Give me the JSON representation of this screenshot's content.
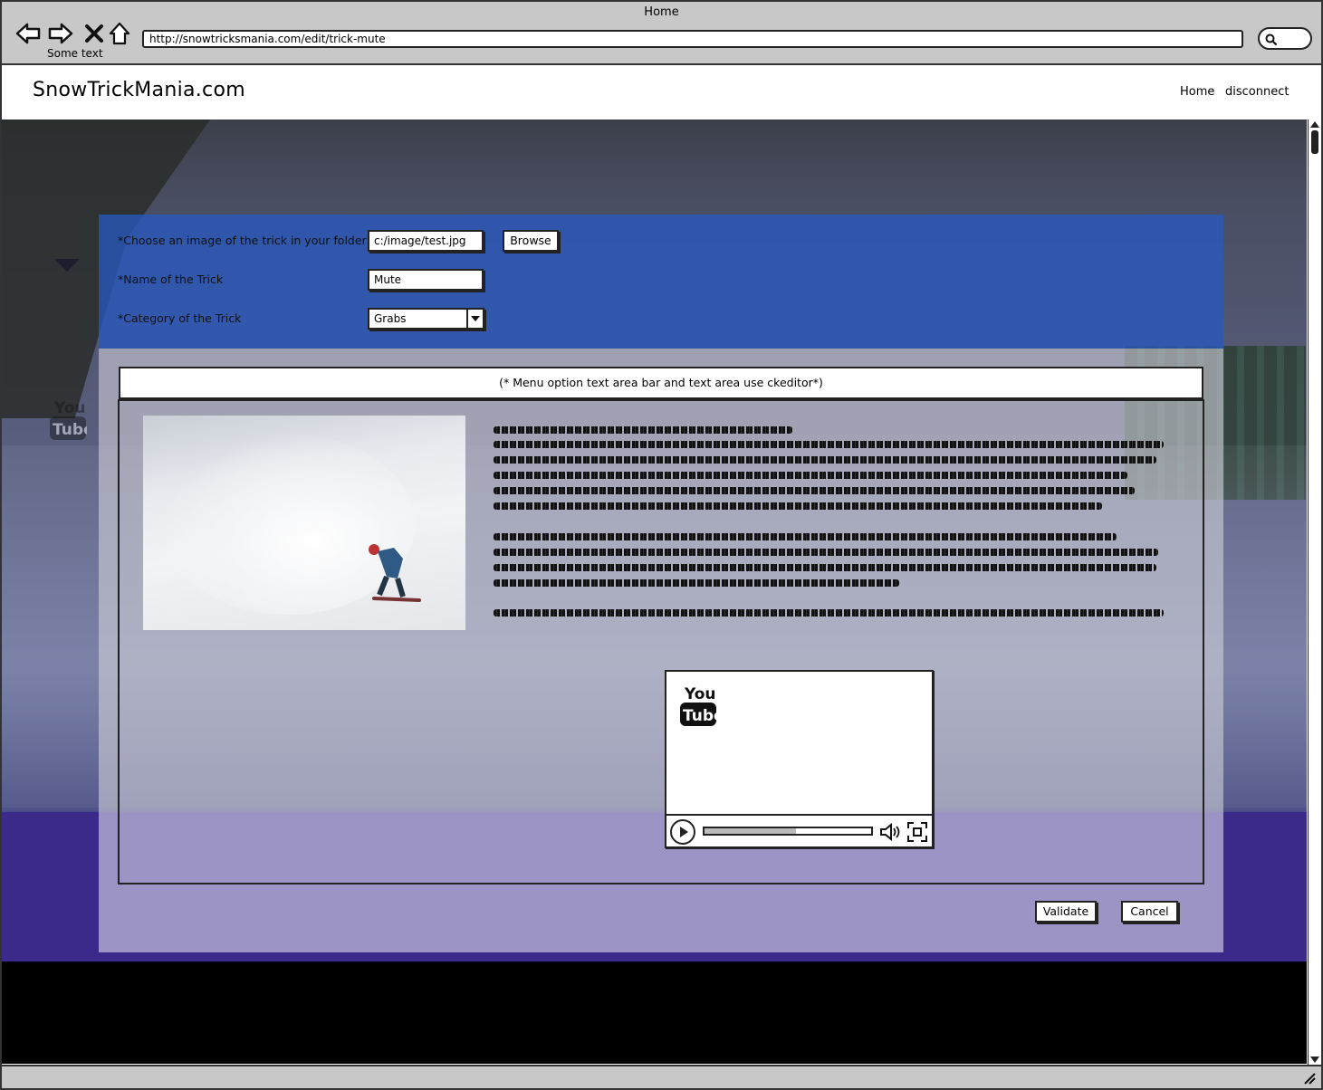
{
  "browser": {
    "window_title": "Home",
    "url": "http://snowtricksmania.com/edit/trick-mute",
    "caption": "Some text"
  },
  "header": {
    "logo": "SnowTrickMania.com",
    "nav": {
      "home": "Home",
      "disconnect": "disconnect"
    }
  },
  "form": {
    "image_label": "*Choose an image of the trick in your folder",
    "image_value": "c:/image/test.jpg",
    "browse_label": "Browse",
    "name_label": "*Name of the Trick",
    "name_value": "Mute",
    "category_label": "*Category of the Trick",
    "category_value": "Grabs",
    "editor_note": "(* Menu option text area bar and text area use ckeditor*)",
    "validate_label": "Validate",
    "cancel_label": "Cancel"
  },
  "video": {
    "provider_top": "You",
    "provider_bottom": "Tube",
    "progress": 0.55
  },
  "side_youtube": {
    "top": "You",
    "bottom": "Tube"
  },
  "colors": {
    "form_top": "#2858be",
    "footer": "#000000",
    "chrome": "#c8c8c8"
  }
}
